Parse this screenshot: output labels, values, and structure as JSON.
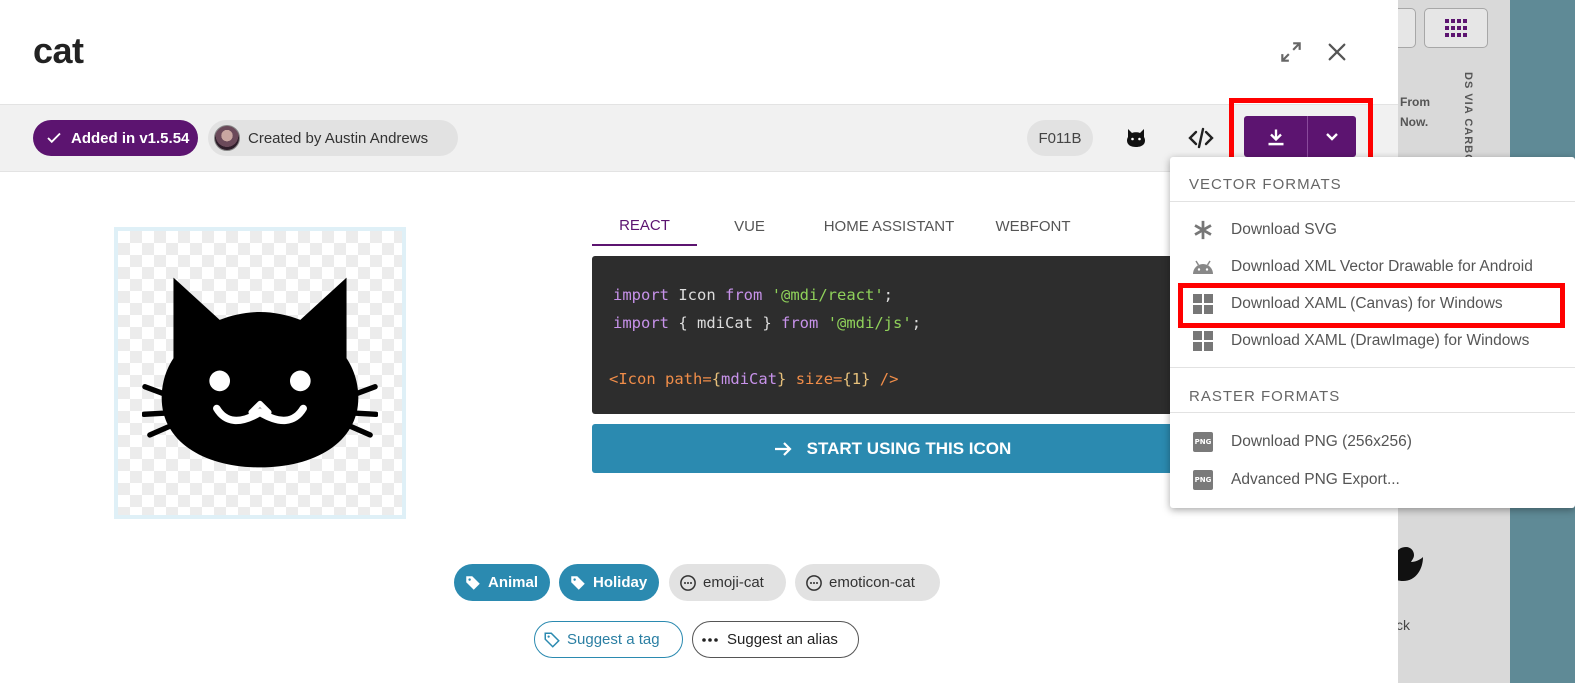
{
  "background": {
    "text_from": "From",
    "text_now": "Now.",
    "vertical_text": "DS VIA CARBON",
    "duck_label": "ck"
  },
  "dialog": {
    "title": "cat",
    "expand_icon": "expand-icon",
    "close_icon": "close-icon",
    "added_label": "Added in v1.5.54",
    "author_label": "Created by Austin Andrews",
    "codepoint": "F011B",
    "accent_color": "#5c1470",
    "action_color": "#2b8ab0"
  },
  "tabs": [
    {
      "label": "REACT"
    },
    {
      "label": "VUE"
    },
    {
      "label": "HOME ASSISTANT"
    },
    {
      "label": "WEBFONT"
    }
  ],
  "code": {
    "line1_kw": "import",
    "line1_name": "Icon",
    "line1_from": "from",
    "line1_str": "'@mdi/react'",
    "line1_end": ";",
    "line2_kw": "import",
    "line2_name": "{ mdiCat }",
    "line2_from": "from",
    "line2_str": "'@mdi/js'",
    "line2_end": ";",
    "line3_open": "<Icon",
    "line3_path": "path=",
    "line3_path_val_open": "{",
    "line3_path_val": "mdiCat",
    "line3_path_val_close": "}",
    "line3_size": "size=",
    "line3_size_val": "{1}",
    "line3_close": "/>"
  },
  "start_button": "START USING THIS ICON",
  "tags": [
    {
      "label": "Animal",
      "kind": "category"
    },
    {
      "label": "Holiday",
      "kind": "category"
    },
    {
      "label": "emoji-cat",
      "kind": "alias"
    },
    {
      "label": "emoticon-cat",
      "kind": "alias"
    }
  ],
  "suggest": {
    "tag": "Suggest a tag",
    "alias": "Suggest an alias"
  },
  "menu": {
    "vector_header": "VECTOR FORMATS",
    "raster_header": "RASTER FORMATS",
    "items": [
      {
        "label": "Download SVG",
        "icon": "asterisk-icon"
      },
      {
        "label": "Download XML Vector Drawable for Android",
        "icon": "android-icon"
      },
      {
        "label": "Download XAML (Canvas) for Windows",
        "icon": "windows-icon"
      },
      {
        "label": "Download XAML (DrawImage) for Windows",
        "icon": "windows-icon"
      },
      {
        "label": "Download PNG (256x256)",
        "icon": "png-icon"
      },
      {
        "label": "Advanced PNG Export...",
        "icon": "png-icon"
      }
    ],
    "png_badge": "PNG"
  }
}
